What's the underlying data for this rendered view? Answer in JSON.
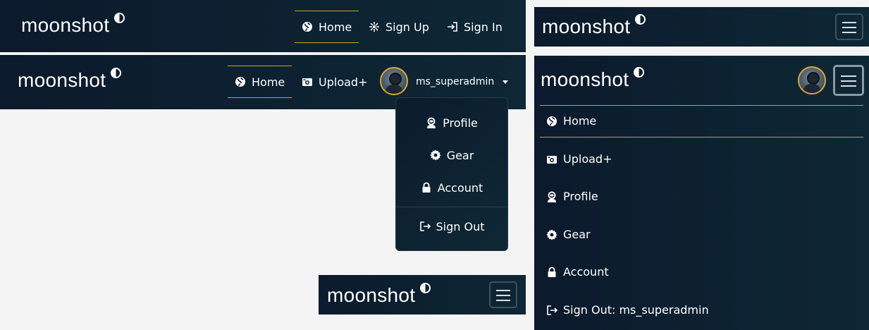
{
  "brand": "moonshot",
  "nav_guest": {
    "links": [
      {
        "label": "Home",
        "icon": "globe-icon",
        "active": true
      },
      {
        "label": "Sign Up",
        "icon": "signup-icon"
      },
      {
        "label": "Sign In",
        "icon": "sign-in-icon"
      }
    ]
  },
  "nav_user": {
    "links": [
      {
        "label": "Home",
        "icon": "globe-icon",
        "active": true
      },
      {
        "label": "Upload+",
        "icon": "camera-icon"
      }
    ],
    "username": "ms_superadmin"
  },
  "dropdown": {
    "items": [
      {
        "label": "Profile",
        "icon": "astronaut-icon"
      },
      {
        "label": "Gear",
        "icon": "gear-icon"
      },
      {
        "label": "Account",
        "icon": "lock-icon"
      },
      {
        "label": "Sign Out",
        "icon": "sign-out-icon"
      }
    ]
  },
  "mobile_menu": {
    "items": [
      {
        "label": "Home",
        "icon": "globe-icon",
        "active": true
      },
      {
        "label": "Upload+",
        "icon": "camera-icon"
      },
      {
        "label": "Profile",
        "icon": "astronaut-icon"
      },
      {
        "label": "Gear",
        "icon": "gear-icon"
      },
      {
        "label": "Account",
        "icon": "lock-icon"
      },
      {
        "label": "Sign Out: ms_superadmin",
        "icon": "sign-out-icon"
      }
    ]
  },
  "colors": {
    "nav_bg": "#0b1a2c",
    "accent": "#c9a227",
    "page_bg": "#f4f4f4"
  }
}
